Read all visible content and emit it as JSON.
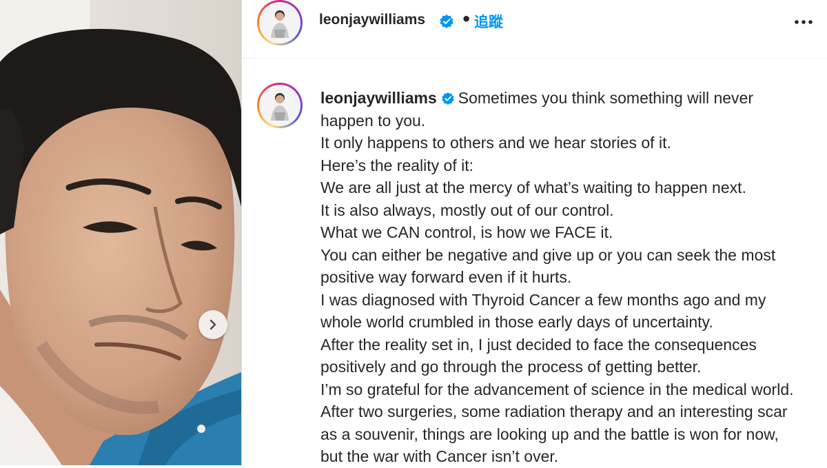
{
  "header": {
    "username": "leonjaywilliams",
    "separator": "•",
    "follow_label": "追蹤",
    "more_icon": "more-horizontal-icon",
    "verified_icon": "verified-badge-icon"
  },
  "carousel": {
    "next_icon": "chevron-right-icon"
  },
  "caption": {
    "username": "leonjaywilliams",
    "lines": [
      "Sometimes you think something will never",
      "happen to you.",
      "It only happens to others and we hear stories of it.",
      "Here’s the reality of it:",
      "We are all just at the mercy of what’s waiting to happen next.",
      "It is also always, mostly out of our control.",
      "What we CAN control, is how we FACE it.",
      "You can either be negative and give up or you can seek the most",
      "positive way forward even if it hurts.",
      "I was diagnosed with Thyroid Cancer a few months ago and my",
      "whole world crumbled in those early days of uncertainty.",
      "After the reality set in, I just decided to face the consequences",
      "positively and go through the process of getting better.",
      "I’m so grateful for the advancement of science in the medical world.",
      "After two surgeries, some radiation therapy and an interesting scar",
      "as a souvenir, things are looking up and the battle is won for now,",
      "but the war with Cancer isn’t over."
    ]
  },
  "colors": {
    "link_blue": "#0095f6",
    "verified_blue": "#0095f6",
    "text": "#262626"
  }
}
